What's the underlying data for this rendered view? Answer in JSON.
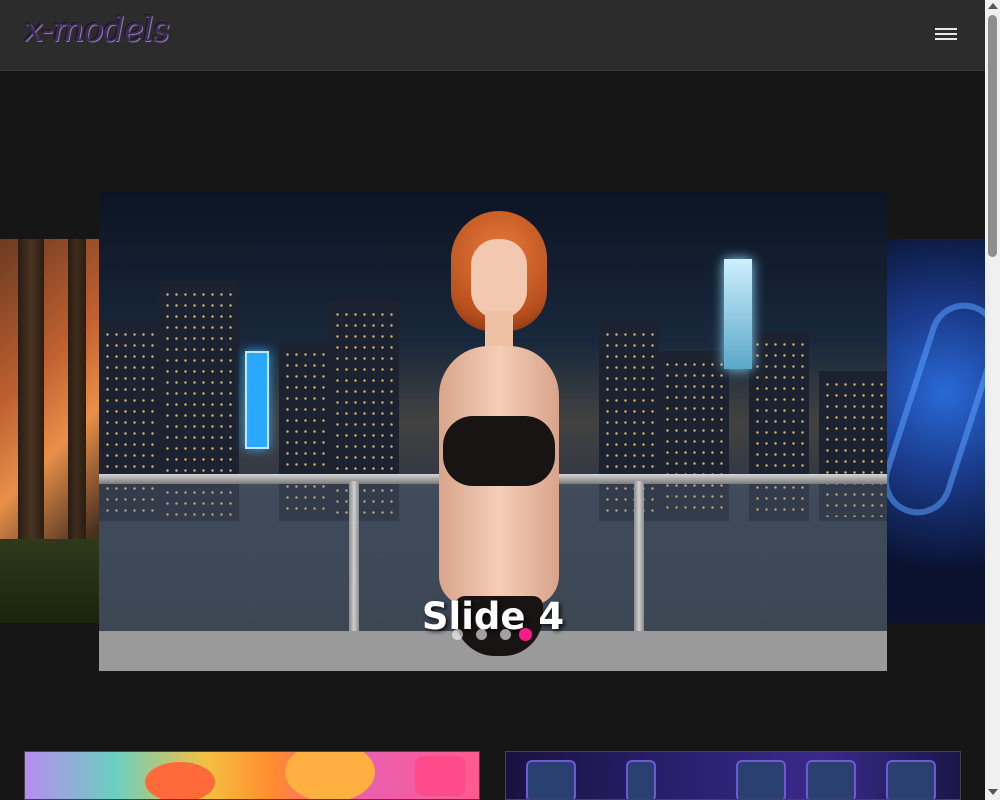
{
  "header": {
    "logo_text": "x-models",
    "menu_icon": "hamburger-menu-icon"
  },
  "carousel": {
    "current_slide_caption": "Slide 4",
    "total_dots": 4,
    "active_dot_index": 3,
    "accent_color": "#ff1a8c"
  },
  "cards": [
    {
      "name": "colorful-3d-promo-card"
    },
    {
      "name": "profile-gallery-promo-card"
    }
  ]
}
